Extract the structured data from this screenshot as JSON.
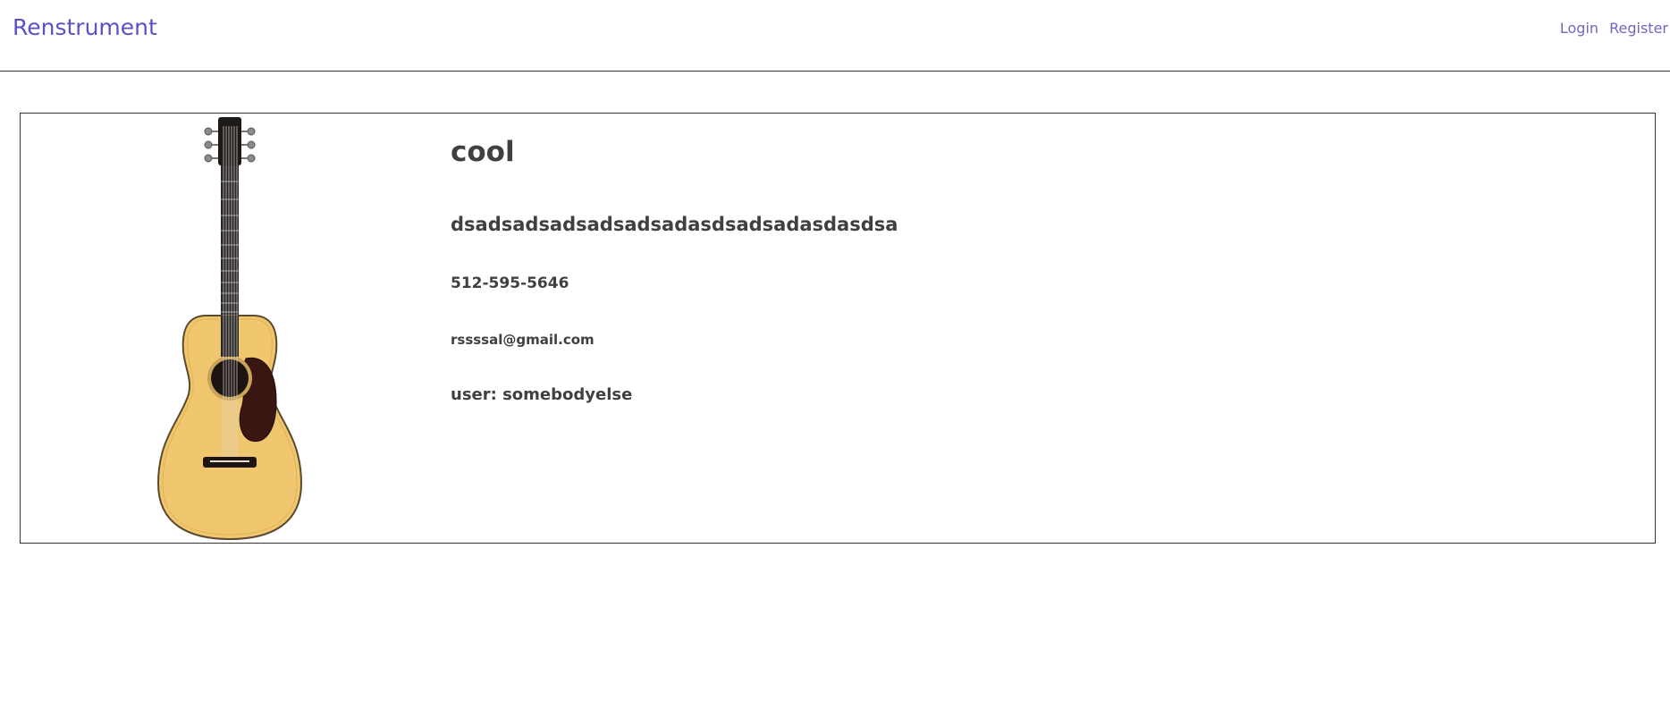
{
  "nav": {
    "brand": "Renstrument",
    "login": "Login",
    "register": "Register"
  },
  "listing": {
    "image_subject": "acoustic-guitar-image",
    "title": "cool",
    "description": "dsadsadsadsadsadsadasdsadsadasdasdsa",
    "phone": "512-595-5646",
    "email": "rssssal@gmail.com",
    "user": "user: somebodyelse"
  },
  "colors": {
    "brand": "#5a50c8",
    "nav_link": "#6f67c0",
    "text": "#404040",
    "border": "#333333"
  }
}
